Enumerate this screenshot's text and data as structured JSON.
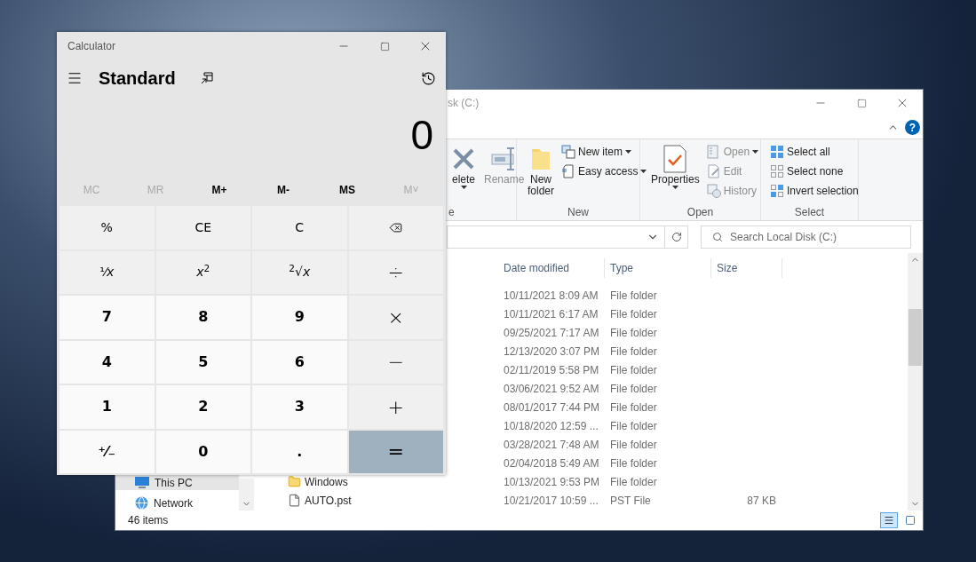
{
  "explorer": {
    "title": "sk (C:)",
    "help": "?",
    "ribbon": [
      {
        "label": "e",
        "items": [
          {
            "kind": "large",
            "label": "elete",
            "disabled": false,
            "dropdown": true
          },
          {
            "kind": "large",
            "label": "Rename",
            "disabled": true,
            "dropdown": false
          }
        ]
      },
      {
        "label": "New",
        "items": [
          {
            "kind": "large",
            "label": "New folder",
            "disabled": false,
            "dropdown": false
          },
          {
            "kind": "small",
            "label": "New item",
            "disabled": false,
            "dropdown": true
          },
          {
            "kind": "small",
            "label": "Easy access",
            "disabled": false,
            "dropdown": true
          }
        ]
      },
      {
        "label": "Open",
        "items": [
          {
            "kind": "large",
            "label": "Properties",
            "disabled": false,
            "dropdown": true
          },
          {
            "kind": "small",
            "label": "Open",
            "disabled": true,
            "dropdown": true
          },
          {
            "kind": "small",
            "label": "Edit",
            "disabled": true,
            "dropdown": false
          },
          {
            "kind": "small",
            "label": "History",
            "disabled": true,
            "dropdown": false
          }
        ]
      },
      {
        "label": "Select",
        "items": [
          {
            "kind": "small",
            "label": "Select all",
            "disabled": false,
            "dropdown": false
          },
          {
            "kind": "small",
            "label": "Select none",
            "disabled": false,
            "dropdown": false
          },
          {
            "kind": "small",
            "label": "Invert selection",
            "disabled": false,
            "dropdown": false
          }
        ]
      }
    ],
    "search": {
      "placeholder": "Search Local Disk (C:)"
    },
    "columns": [
      "Date modified",
      "Type",
      "Size"
    ],
    "rows": [
      {
        "date": "10/11/2021 8:09 AM",
        "type": "File folder"
      },
      {
        "date": "10/11/2021 6:17 AM",
        "type": "File folder"
      },
      {
        "date": "09/25/2021 7:17 AM",
        "type": "File folder"
      },
      {
        "date": "12/13/2020 3:07 PM",
        "type": "File folder"
      },
      {
        "date": "02/11/2019 5:58 PM",
        "type": "File folder"
      },
      {
        "date": "03/06/2021 9:52 AM",
        "type": "File folder"
      },
      {
        "date": "08/01/2017 7:44 PM",
        "type": "File folder"
      },
      {
        "date": "10/18/2020 12:59 ...",
        "type": "File folder"
      },
      {
        "date": "03/28/2021 7:48 AM",
        "type": "File folder"
      },
      {
        "date": "02/04/2018 5:49 AM",
        "type": "File folder"
      },
      {
        "kind": "folder",
        "name": "Windows",
        "date": "10/13/2021 9:53 PM",
        "type": "File folder"
      },
      {
        "kind": "file",
        "name": "AUTO.pst",
        "date": "10/21/2017 10:59 ...",
        "type": "PST File",
        "size": "87 KB"
      }
    ],
    "nav": [
      {
        "kind": "pc",
        "label": "This PC",
        "selected": true
      },
      {
        "kind": "network",
        "label": "Network",
        "selected": false
      }
    ],
    "status": "46 items"
  },
  "calculator": {
    "title": "Calculator",
    "mode": "Standard",
    "display": "0",
    "memory": [
      {
        "label": "MC",
        "disabled": true
      },
      {
        "label": "MR",
        "disabled": true
      },
      {
        "label": "M+",
        "disabled": false
      },
      {
        "label": "M-",
        "disabled": false
      },
      {
        "label": "MS",
        "disabled": false
      },
      {
        "label": "M˅",
        "disabled": true
      }
    ],
    "keys": [
      {
        "kind": "fn",
        "label": "%"
      },
      {
        "kind": "fn",
        "label": "CE"
      },
      {
        "kind": "fn",
        "label": "C"
      },
      {
        "kind": "backspace"
      },
      {
        "kind": "fn",
        "label": "¹⁄*x*"
      },
      {
        "kind": "fn",
        "label": "*x*$^{2}$"
      },
      {
        "kind": "fn",
        "label": "$^{2}$√*x*"
      },
      {
        "kind": "op",
        "label": "÷"
      },
      {
        "kind": "digit",
        "label": "7"
      },
      {
        "kind": "digit",
        "label": "8"
      },
      {
        "kind": "digit",
        "label": "9"
      },
      {
        "kind": "op",
        "label": "×"
      },
      {
        "kind": "digit",
        "label": "4"
      },
      {
        "kind": "digit",
        "label": "5"
      },
      {
        "kind": "digit",
        "label": "6"
      },
      {
        "kind": "op",
        "label": "−"
      },
      {
        "kind": "digit",
        "label": "1"
      },
      {
        "kind": "digit",
        "label": "2"
      },
      {
        "kind": "digit",
        "label": "3"
      },
      {
        "kind": "op",
        "label": "+"
      },
      {
        "kind": "digit",
        "label": "⁺⁄₋"
      },
      {
        "kind": "digit",
        "label": "0"
      },
      {
        "kind": "digit",
        "label": "."
      },
      {
        "kind": "equals",
        "label": "="
      }
    ]
  }
}
